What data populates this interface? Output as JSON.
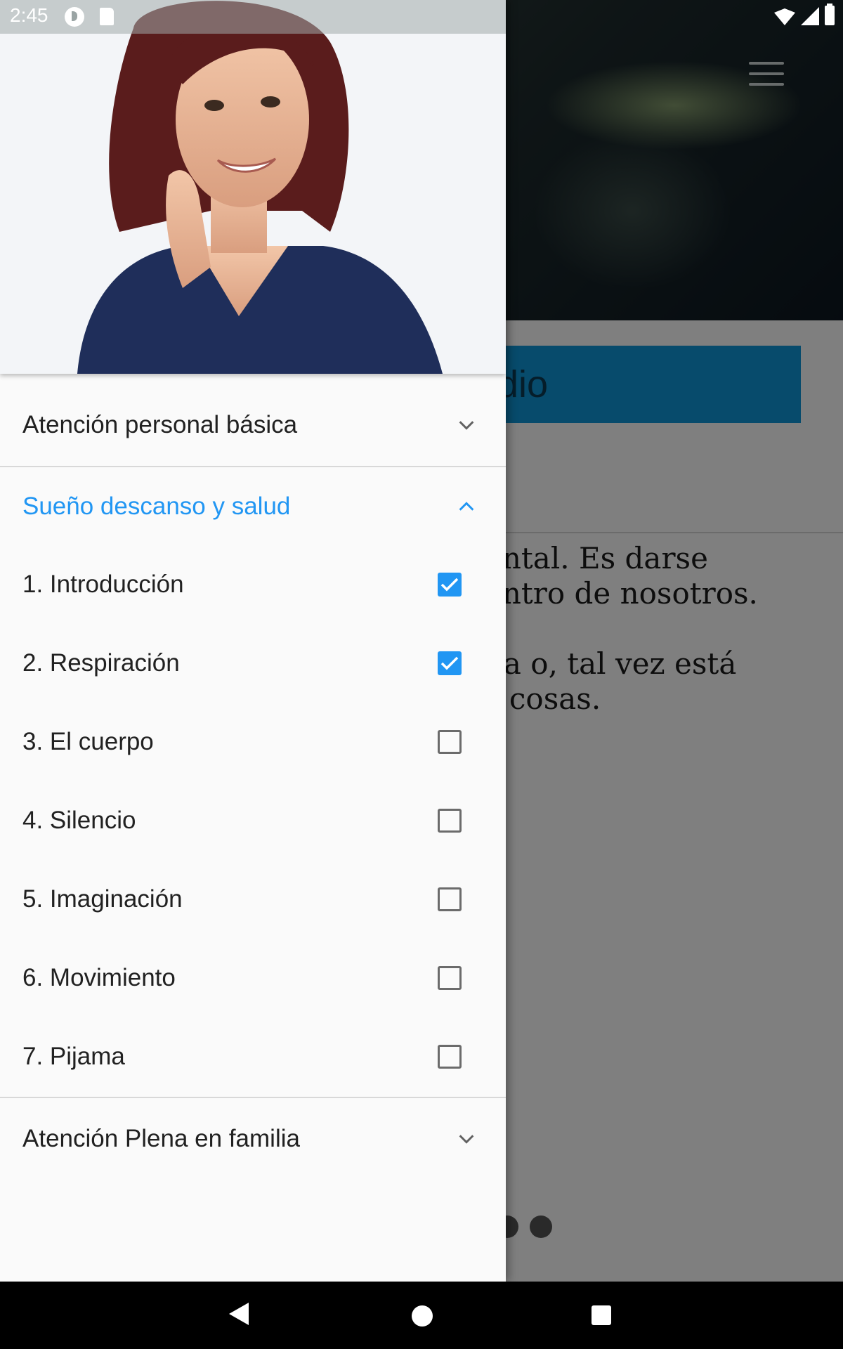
{
  "status_bar": {
    "time": "2:45",
    "icons": [
      "p-notification-icon",
      "sd-card-icon",
      "wifi-icon",
      "signal-icon",
      "battery-icon"
    ]
  },
  "background_page": {
    "banner_text": "dio",
    "paragraph_lines": [
      "ental. Es darse",
      "entro de nosotros.",
      "da o, tal vez está",
      "s cosas."
    ],
    "accent_color": "#0f96d8"
  },
  "drawer": {
    "header_image": "portrait-photo",
    "sections": [
      {
        "title": "Atención personal básica",
        "expanded": false
      },
      {
        "title": "Sueño descanso y salud",
        "expanded": true
      },
      {
        "title": "Atención Plena en familia",
        "expanded": false
      }
    ],
    "lessons": [
      {
        "label": "1. Introducción",
        "checked": true
      },
      {
        "label": "2. Respiración",
        "checked": true
      },
      {
        "label": "3. El cuerpo",
        "checked": false
      },
      {
        "label": "4. Silencio",
        "checked": false
      },
      {
        "label": "5. Imaginación",
        "checked": false
      },
      {
        "label": "6. Movimiento",
        "checked": false
      },
      {
        "label": "7. Pijama",
        "checked": false
      }
    ],
    "active_color": "#2196f3"
  },
  "nav_bar": {
    "icons": [
      "back-icon",
      "home-icon",
      "recents-icon"
    ]
  }
}
